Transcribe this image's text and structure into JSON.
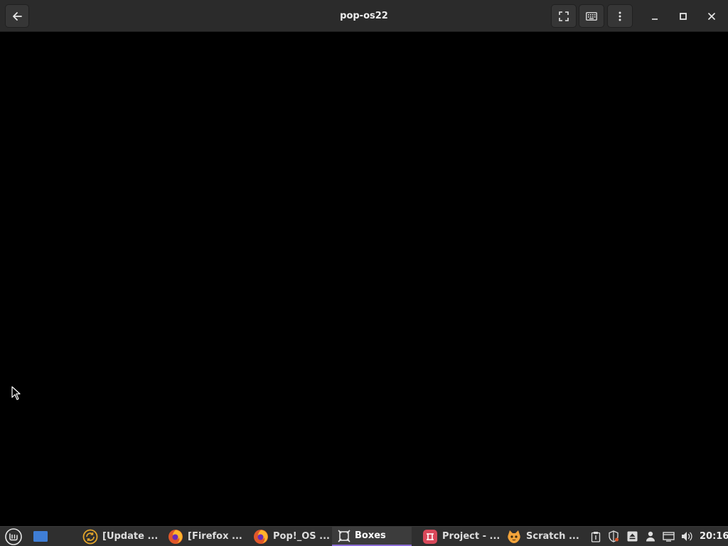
{
  "window": {
    "title": "pop-os22",
    "back_icon": "arrow-left-icon",
    "fullscreen_icon": "fullscreen-icon",
    "keyboard_icon": "keyboard-icon",
    "menu_icon": "kebab-menu-icon",
    "minimize_icon": "minimize-icon",
    "maximize_icon": "maximize-icon",
    "close_icon": "close-icon"
  },
  "taskbar": {
    "menu_icon": "mint-menu-icon",
    "show_desktop_icon": "show-desktop-icon",
    "tasks": [
      {
        "label": "[Update ...",
        "icon": "update-manager-icon",
        "active": false
      },
      {
        "label": "[Firefox ...",
        "icon": "firefox-icon",
        "active": false
      },
      {
        "label": "Pop!_OS ...",
        "icon": "firefox-icon",
        "active": false
      },
      {
        "label": "Boxes",
        "icon": "boxes-icon",
        "active": true
      },
      {
        "label": "Project - ...",
        "icon": "project-app-icon",
        "active": false
      },
      {
        "label": "Scratch ...",
        "icon": "scratch-icon",
        "active": false
      }
    ],
    "tray_icons": [
      "clipboard-icon",
      "shield-icon",
      "eject-icon",
      "user-icon",
      "display-icon",
      "volume-icon"
    ],
    "clock": "20:16"
  },
  "colors": {
    "titlebar_bg": "#2b2b2b",
    "display_bg": "#000000",
    "taskbar_bg": "#2f2f2f",
    "active_task_accent": "#8a6bd6"
  }
}
